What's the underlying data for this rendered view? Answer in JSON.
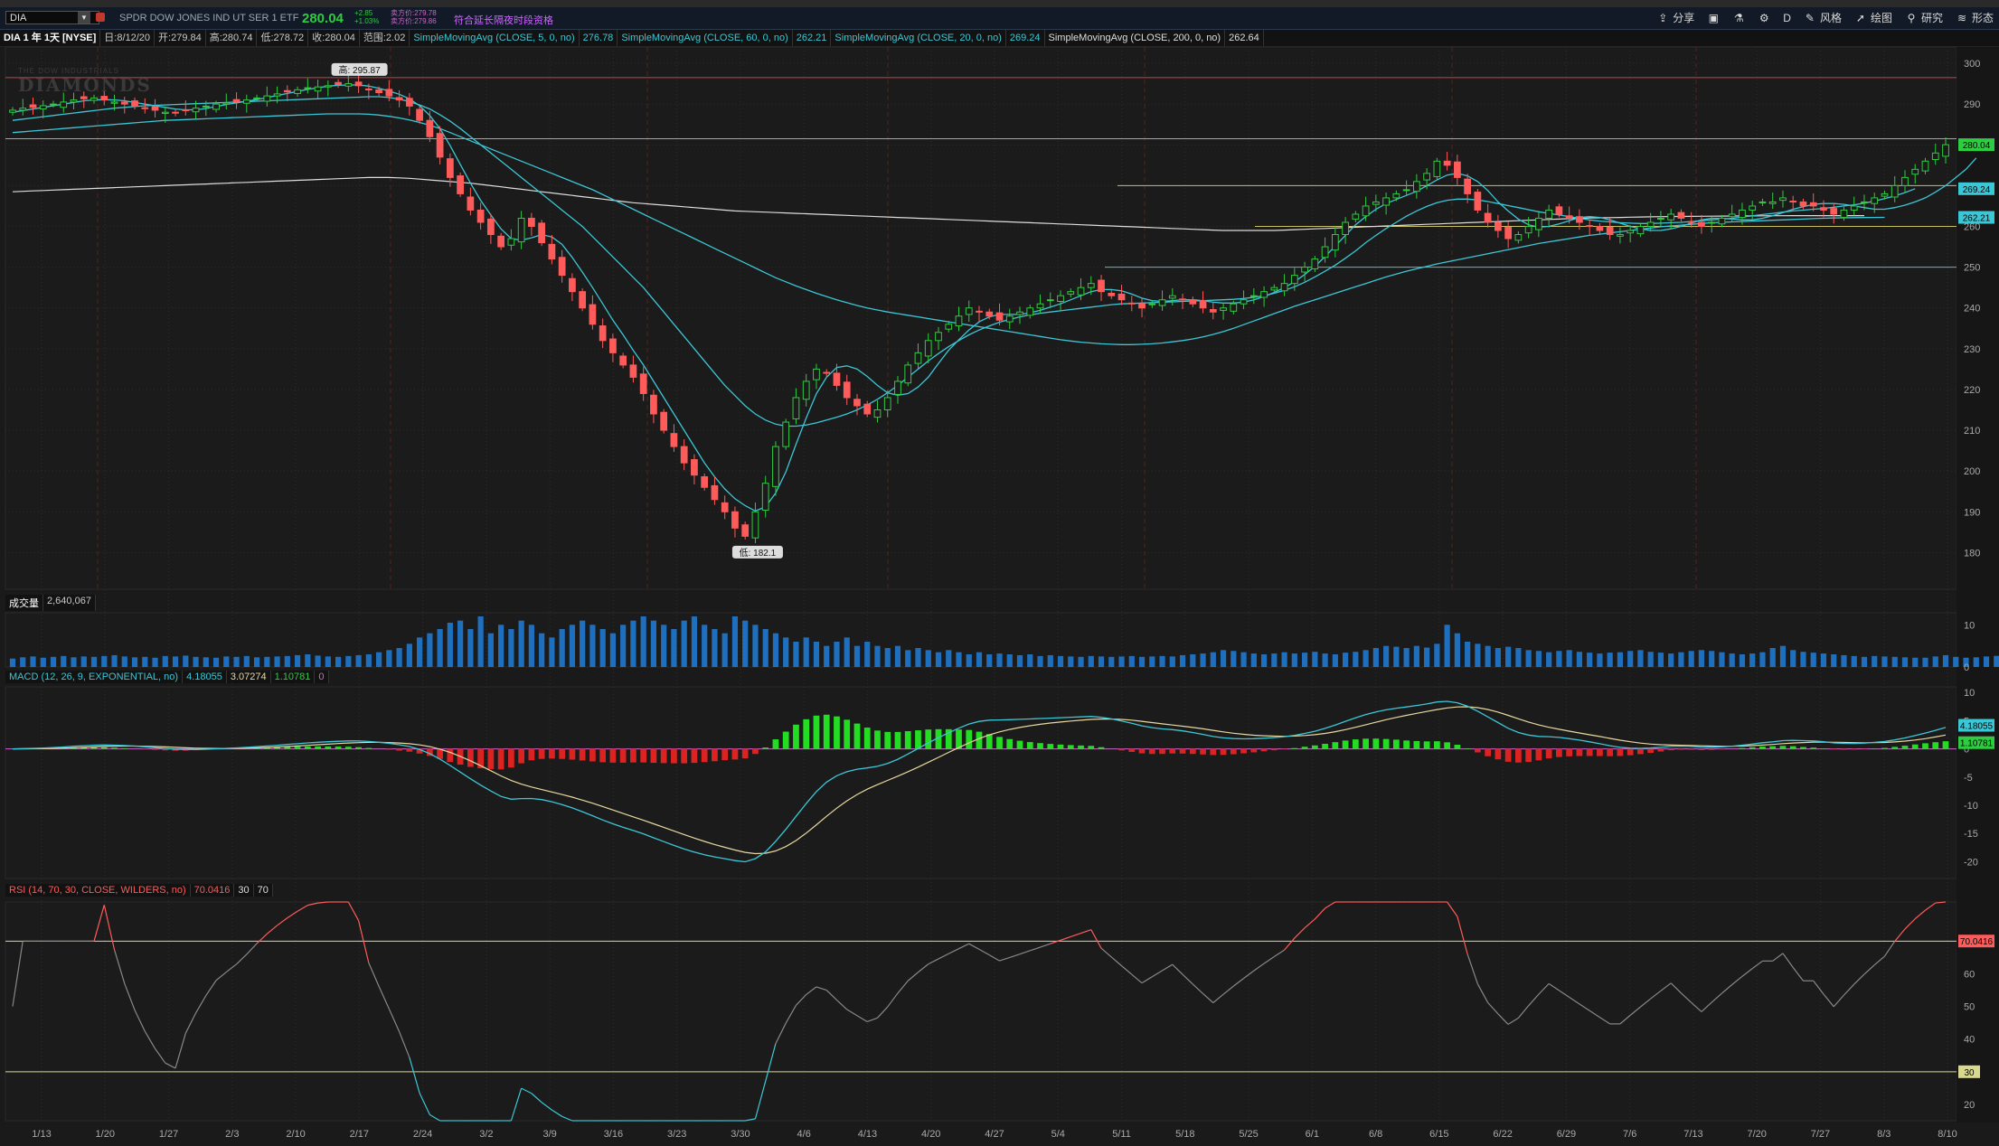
{
  "toolbar": {
    "symbol": "DIA",
    "description": "SPDR DOW JONES IND UT SER 1 ETF",
    "last": "280.04",
    "change": "+2.85",
    "change_pct": "+1.03%",
    "bid": "卖方价:279.78",
    "ask": "卖方价:279.86",
    "extended": "符合延长隔夜时段资格",
    "items": [
      {
        "icon": "share-icon",
        "label": "分享"
      },
      {
        "icon": "screenshot-icon",
        "label": ""
      },
      {
        "icon": "flask-icon",
        "label": ""
      },
      {
        "icon": "gear-icon",
        "label": ""
      },
      {
        "icon": "aggregation-label",
        "label": "D"
      },
      {
        "icon": "style-icon",
        "label": "风格"
      },
      {
        "icon": "cursor-icon",
        "label": "绘图"
      },
      {
        "icon": "research-icon",
        "label": "研究"
      },
      {
        "icon": "pattern-icon",
        "label": "形态"
      }
    ]
  },
  "info": {
    "title": "DIA 1 年 1天 [NYSE]",
    "date": "日:8/12/20",
    "open": "开:279.84",
    "high": "高:280.74",
    "low": "低:278.72",
    "close": "收:280.04",
    "range": "范围:2.02",
    "studies": [
      {
        "label": "SimpleMovingAvg (CLOSE, 5, 0, no)",
        "value": "276.78"
      },
      {
        "label": "SimpleMovingAvg (CLOSE, 60, 0, no)",
        "value": "262.21"
      },
      {
        "label": "SimpleMovingAvg (CLOSE, 20, 0, no)",
        "value": "269.24"
      },
      {
        "label": "SimpleMovingAvg (CLOSE, 200, 0, no)",
        "value": "262.64"
      }
    ]
  },
  "watermark": {
    "small": "THE DOW INDUSTRIALS",
    "big": "DIAMONDS"
  },
  "panels": {
    "volume": {
      "label": "成交量",
      "value": "2,640,067"
    },
    "macd": {
      "label": "MACD (12, 26, 9, EXPONENTIAL, no)",
      "v1": "4.18055",
      "v2": "3.07274",
      "v3": "1.10781",
      "v4": "0"
    },
    "rsi": {
      "label": "RSI (14, 70, 30, CLOSE, WILDERS, no)",
      "v1": "70.0416",
      "v2": "30",
      "v3": "70"
    }
  },
  "colors": {
    "up": "#2ecc40",
    "down": "#ff5b5b",
    "sma": "#3cc7d6",
    "sma200": "#dddddd",
    "yellow": "#c8c060",
    "grid": "#2c2c2c"
  },
  "chart_data": {
    "type": "candlestick",
    "x_labels": [
      "1/13",
      "1/20",
      "1/27",
      "2/3",
      "2/10",
      "2/17",
      "2/24",
      "3/2",
      "3/9",
      "3/16",
      "3/23",
      "3/30",
      "4/6",
      "4/13",
      "4/20",
      "4/27",
      "5/4",
      "5/11",
      "5/18",
      "5/25",
      "6/1",
      "6/8",
      "6/15",
      "6/22",
      "6/29",
      "7/6",
      "7/13",
      "7/20",
      "7/27",
      "8/3",
      "8/10"
    ],
    "price_ticks": [
      180,
      190,
      200,
      210,
      220,
      230,
      240,
      250,
      260,
      270,
      280,
      290,
      300
    ],
    "price_range": [
      171,
      304
    ],
    "high_label": "高: 295.87",
    "low_label": "低: 182.1",
    "price_badges": [
      {
        "value": 280.04,
        "label": "280.04",
        "color": "#2ecc40"
      },
      {
        "value": 269.24,
        "label": "269.24",
        "color": "#3cc7d6"
      },
      {
        "value": 262.21,
        "label": "262.21",
        "color": "#3cc7d6"
      }
    ],
    "horizontal_lines": [
      {
        "value": 296.5,
        "color": "#c04848"
      },
      {
        "value": 281.5,
        "color": "#9aa3d8"
      },
      {
        "value": 270,
        "color": "#c8c060"
      },
      {
        "value": 260,
        "color": "#c8c060"
      },
      {
        "value": 250,
        "color": "#3cc7d6"
      }
    ],
    "closes": [
      288.5,
      289,
      289.2,
      289.6,
      290,
      290.5,
      291,
      291.3,
      291.5,
      291,
      290.5,
      290,
      289.5,
      289,
      288.5,
      288,
      287.8,
      288.5,
      289,
      289.5,
      290,
      290.3,
      290.6,
      291,
      291.5,
      292,
      292.5,
      293,
      293.5,
      294,
      294.2,
      294.5,
      294.8,
      295,
      294.5,
      293.5,
      292.8,
      292,
      291,
      289.5,
      286,
      282,
      277,
      272,
      268,
      264,
      261,
      258,
      255,
      257,
      262,
      260,
      256,
      252,
      248,
      244,
      240,
      236,
      232,
      229,
      226,
      223,
      219,
      214,
      210,
      206,
      202,
      199,
      196,
      193,
      190,
      186,
      184,
      190,
      197,
      206,
      212,
      218,
      222,
      225,
      224,
      221,
      218,
      216,
      214,
      215,
      218,
      222,
      226,
      229,
      232,
      234,
      236,
      238,
      240,
      239,
      238,
      237,
      238,
      239,
      240,
      241,
      242,
      243,
      244,
      245,
      246,
      244,
      243,
      242,
      241,
      240,
      241,
      242,
      243,
      242,
      241,
      240,
      239,
      240,
      241,
      242,
      243,
      244,
      245,
      246,
      248,
      250,
      252,
      255,
      258,
      261,
      263,
      265,
      266,
      267,
      268,
      269,
      271,
      273,
      276,
      275,
      272,
      268,
      264,
      261,
      259,
      257,
      258,
      260,
      262,
      264,
      263,
      262,
      261,
      260,
      259,
      258,
      258,
      259,
      260,
      261,
      262,
      263,
      262,
      261,
      260,
      261,
      262,
      263,
      264,
      265,
      266,
      266,
      267,
      266,
      265,
      265,
      264,
      263,
      264,
      265,
      266,
      267,
      268,
      270,
      272,
      274,
      276,
      278,
      280.04
    ],
    "sma5": [
      288,
      288.4,
      288.8,
      289.2,
      289.6,
      290,
      290.4,
      290.8,
      291,
      291.1,
      291,
      290.8,
      290.4,
      290,
      289.6,
      289.2,
      288.8,
      288.6,
      288.6,
      288.9,
      289.4,
      289.9,
      290.3,
      290.7,
      291.1,
      291.6,
      292.1,
      292.6,
      293.1,
      293.6,
      294,
      294.4,
      294.6,
      294.7,
      294.7,
      294.4,
      293.9,
      293.2,
      292.4,
      291.3,
      289.6,
      287.2,
      284,
      279.8,
      275.2,
      270.6,
      266.4,
      262.8,
      259.4,
      257,
      256.6,
      257.2,
      258,
      257.4,
      255.6,
      252.4,
      248.8,
      245,
      241,
      237,
      233.4,
      229.6,
      226,
      222,
      218,
      214,
      210,
      206,
      202,
      198.6,
      195.6,
      193.2,
      191.5,
      190.2,
      191.2,
      194.6,
      199.8,
      206.6,
      213,
      219,
      223,
      225.4,
      225.8,
      225,
      223.2,
      221,
      219.2,
      218.6,
      219,
      220.6,
      223,
      226.4,
      229.6,
      232.2,
      234.6,
      236.6,
      237.8,
      238.4,
      238.4,
      238.4,
      238.8,
      239.4,
      240.2,
      241,
      242,
      243,
      244,
      244.5,
      244.5,
      244.2,
      243.4,
      242.4,
      241.8,
      241.6,
      241.8,
      242,
      242,
      241.8,
      241.4,
      241.2,
      241.2,
      241.4,
      242,
      242.8,
      243.8,
      245,
      246.4,
      248.2,
      250.2,
      252.6,
      255.2,
      257.8,
      260.4,
      262.4,
      264.2,
      265.6,
      266.6,
      267.6,
      268.6,
      270,
      271.4,
      272.6,
      273,
      272.4,
      271,
      268.8,
      266,
      263.8,
      261.8,
      260.4,
      259.8,
      260,
      260.6,
      261.4,
      262.2,
      262.4,
      262.2,
      261.6,
      260.8,
      260,
      259.4,
      259,
      259,
      259.4,
      260,
      260.8,
      261.6,
      262,
      262,
      261.8,
      261.6,
      261.6,
      262,
      262.6,
      263.4,
      264.2,
      264.8,
      265.4,
      265.6,
      265.6,
      265.4,
      265,
      264.6,
      264.2,
      264.2,
      264.6,
      265.2,
      266,
      267,
      268.4,
      270,
      272,
      274,
      276.78
    ],
    "sma20": [
      286,
      286.3,
      286.6,
      286.9,
      287.2,
      287.5,
      287.8,
      288.1,
      288.4,
      288.7,
      289,
      289.2,
      289.4,
      289.6,
      289.7,
      289.8,
      289.9,
      290,
      290.1,
      290.2,
      290.3,
      290.4,
      290.5,
      290.6,
      290.7,
      290.8,
      290.9,
      291,
      291.1,
      291.2,
      291.3,
      291.4,
      291.5,
      291.6,
      291.7,
      291.8,
      291.8,
      291.6,
      291.2,
      290.6,
      289.8,
      288.8,
      287.4,
      285.8,
      284,
      282,
      280,
      278,
      276,
      274,
      272,
      270,
      268,
      266,
      264,
      262,
      260,
      257.5,
      255,
      252.5,
      250,
      247.5,
      245,
      242,
      239,
      236,
      233,
      230,
      227,
      224,
      221,
      218.5,
      216,
      214,
      212.5,
      211.5,
      211,
      211,
      211.3,
      211.8,
      212.5,
      213.2,
      214,
      215,
      216.2,
      217.6,
      219.2,
      221,
      223,
      225,
      227,
      228.8,
      230.5,
      232,
      233.4,
      234.6,
      235.6,
      236.5,
      237.2,
      237.8,
      238.3,
      238.7,
      239,
      239.3,
      239.6,
      239.9,
      240.2,
      240.5,
      240.8,
      241,
      241.1,
      241.2,
      241.3,
      241.4,
      241.5,
      241.6,
      241.7,
      241.8,
      241.9,
      242,
      242.1,
      242.3,
      242.6,
      243,
      243.6,
      244.3,
      245.2,
      246.3,
      247.6,
      249,
      250.5,
      252.2,
      254,
      256,
      257.8,
      259.5,
      261,
      262.5,
      263.8,
      264.9,
      265.8,
      266.4,
      266.7,
      266.7,
      266.5,
      266.1,
      265.6,
      265.1,
      264.6,
      264.1,
      263.6,
      263.2,
      262.8,
      262.4,
      262,
      261.6,
      261.3,
      261.1,
      260.9,
      260.8,
      260.7,
      260.7,
      260.8,
      260.9,
      261,
      261.2,
      261.4,
      261.6,
      261.8,
      262,
      262.3,
      262.6,
      262.9,
      263.2,
      263.5,
      263.8,
      264,
      264.2,
      264.4,
      264.7,
      265,
      265.3,
      265.7,
      266.2,
      266.8,
      267.5,
      268.3,
      269.24
    ],
    "sma60": [
      283,
      283.2,
      283.4,
      283.6,
      283.8,
      284,
      284.2,
      284.4,
      284.6,
      284.8,
      285,
      285.2,
      285.4,
      285.6,
      285.8,
      286,
      286.1,
      286.2,
      286.3,
      286.4,
      286.5,
      286.6,
      286.7,
      286.8,
      286.9,
      287,
      287.1,
      287.2,
      287.3,
      287.4,
      287.5,
      287.6,
      287.6,
      287.6,
      287.6,
      287.5,
      287.3,
      287,
      286.6,
      286.1,
      285.5,
      284.8,
      284,
      283,
      282,
      281,
      280,
      279,
      278,
      277,
      276,
      275,
      274,
      273,
      272,
      271,
      270,
      269,
      267.8,
      266.6,
      265.4,
      264.2,
      263,
      261.8,
      260.6,
      259.4,
      258.2,
      257,
      255.8,
      254.6,
      253.4,
      252.2,
      251,
      249.8,
      248.6,
      247.4,
      246.4,
      245.4,
      244.5,
      243.6,
      242.8,
      242,
      241.3,
      240.6,
      240,
      239.5,
      239,
      238.6,
      238.2,
      237.8,
      237.4,
      237,
      236.6,
      236.2,
      235.8,
      235.4,
      235,
      234.6,
      234.2,
      233.8,
      233.4,
      233,
      232.6,
      232.2,
      231.9,
      231.6,
      231.4,
      231.2,
      231.1,
      231,
      231,
      231.1,
      231.2,
      231.4,
      231.7,
      232,
      232.4,
      232.9,
      233.5,
      234.2,
      235,
      235.9,
      236.8,
      237.7,
      238.6,
      239.5,
      240.4,
      241.2,
      242,
      242.8,
      243.6,
      244.4,
      245.2,
      246,
      246.8,
      247.6,
      248.3,
      249,
      249.6,
      250.2,
      250.8,
      251.3,
      251.8,
      252.3,
      252.8,
      253.3,
      253.8,
      254.3,
      254.8,
      255.3,
      255.8,
      256.2,
      256.6,
      257,
      257.4,
      257.8,
      258.1,
      258.4,
      258.7,
      259,
      259.3,
      259.6,
      259.9,
      260.1,
      260.3,
      260.5,
      260.7,
      260.9,
      261,
      261.1,
      261.2,
      261.3,
      261.4,
      261.5,
      261.6,
      261.7,
      261.8,
      261.9,
      262,
      262.05,
      262.1,
      262.15,
      262.18,
      262.2,
      262.21
    ],
    "sma200": [
      268.5,
      268.6,
      268.7,
      268.8,
      268.9,
      269,
      269.1,
      269.2,
      269.3,
      269.4,
      269.5,
      269.6,
      269.7,
      269.8,
      269.9,
      270,
      270.1,
      270.2,
      270.3,
      270.4,
      270.5,
      270.6,
      270.7,
      270.8,
      270.9,
      271,
      271.1,
      271.2,
      271.3,
      271.4,
      271.5,
      271.6,
      271.7,
      271.8,
      271.9,
      272,
      272,
      272,
      271.9,
      271.8,
      271.6,
      271.4,
      271.2,
      271,
      270.8,
      270.6,
      270.3,
      270,
      269.7,
      269.4,
      269.1,
      268.8,
      268.5,
      268.2,
      267.9,
      267.6,
      267.3,
      267,
      266.7,
      266.4,
      266.1,
      265.8,
      265.6,
      265.4,
      265.2,
      265,
      264.8,
      264.6,
      264.4,
      264.2,
      264,
      263.8,
      263.7,
      263.6,
      263.5,
      263.4,
      263.3,
      263.2,
      263.1,
      263,
      262.9,
      262.8,
      262.7,
      262.6,
      262.5,
      262.4,
      262.3,
      262.2,
      262.1,
      262,
      261.9,
      261.8,
      261.7,
      261.6,
      261.5,
      261.4,
      261.3,
      261.2,
      261.1,
      261,
      260.9,
      260.8,
      260.7,
      260.6,
      260.5,
      260.4,
      260.3,
      260.2,
      260.1,
      260,
      259.9,
      259.8,
      259.7,
      259.6,
      259.5,
      259.4,
      259.3,
      259.2,
      259.1,
      259,
      259,
      259,
      259,
      259,
      259,
      259.1,
      259.2,
      259.3,
      259.4,
      259.5,
      259.6,
      259.7,
      259.8,
      259.9,
      260,
      260.1,
      260.2,
      260.3,
      260.4,
      260.5,
      260.6,
      260.7,
      260.8,
      260.9,
      261,
      261.1,
      261.2,
      261.3,
      261.4,
      261.5,
      261.6,
      261.7,
      261.8,
      261.9,
      262,
      262.05,
      262.1,
      262.15,
      262.2,
      262.25,
      262.3,
      262.35,
      262.4,
      262.42,
      262.44,
      262.46,
      262.48,
      262.5,
      262.52,
      262.54,
      262.56,
      262.58,
      262.6,
      262.61,
      262.62,
      262.63,
      262.64,
      262.64,
      262.64,
      262.64,
      262.64,
      262.64,
      262.64
    ],
    "volume": [
      2,
      2.3,
      2.5,
      2.2,
      2.4,
      2.6,
      2.3,
      2.5,
      2.4,
      2.6,
      2.8,
      2.5,
      2.3,
      2.4,
      2.2,
      2.6,
      2.5,
      2.7,
      2.4,
      2.3,
      2.2,
      2.5,
      2.4,
      2.6,
      2.3,
      2.4,
      2.5,
      2.6,
      2.8,
      3,
      2.7,
      2.5,
      2.4,
      2.6,
      2.8,
      3,
      3.5,
      4,
      4.5,
      5.5,
      7,
      8,
      9,
      10.5,
      11,
      9,
      12,
      8,
      10,
      9,
      11,
      10,
      8,
      7,
      9,
      10,
      11,
      10,
      9,
      8,
      10,
      11,
      12,
      11,
      10,
      9,
      11,
      12,
      10,
      9,
      8,
      12,
      11,
      10,
      9,
      8,
      7,
      6,
      7,
      6,
      5,
      6,
      7,
      5,
      6,
      5,
      4.5,
      5,
      4,
      4.5,
      4,
      3.5,
      4,
      3.5,
      3,
      3.5,
      3,
      3.2,
      3,
      2.8,
      3,
      2.6,
      2.8,
      2.6,
      2.5,
      2.4,
      2.6,
      2.5,
      2.4,
      2.5,
      2.6,
      2.4,
      2.5,
      2.6,
      2.5,
      2.8,
      3,
      3.2,
      3.5,
      4,
      3.8,
      3.5,
      3.2,
      3,
      3.2,
      3.5,
      3.2,
      3.4,
      3.6,
      3.2,
      3,
      3.4,
      3.6,
      4,
      4.5,
      5,
      4.8,
      4.5,
      5,
      4.6,
      5.5,
      10,
      8,
      6,
      5.5,
      5,
      4.5,
      4.8,
      4.5,
      4,
      3.8,
      3.5,
      3.8,
      4,
      3.6,
      3.4,
      3.2,
      3.4,
      3.5,
      3.8,
      4,
      3.6,
      3.4,
      3.2,
      3.5,
      3.8,
      4,
      3.8,
      3.5,
      3.2,
      3,
      3.2,
      3.5,
      4.5,
      5,
      4,
      3.6,
      3.4,
      3.2,
      3,
      2.8,
      2.6,
      2.4,
      2.6,
      2.5,
      2.4,
      2.3,
      2.2,
      2.2,
      2.5,
      2.8,
      2.4,
      2.2,
      2.3,
      2.5,
      2.64
    ],
    "volume_ticks": [
      0,
      10
    ],
    "macd_ticks": [
      10,
      5,
      0,
      -5,
      -10,
      -15,
      -20
    ],
    "rsi_ticks": [
      20,
      30,
      40,
      50,
      60,
      70
    ],
    "rsi_levels": [
      30,
      70
    ]
  }
}
